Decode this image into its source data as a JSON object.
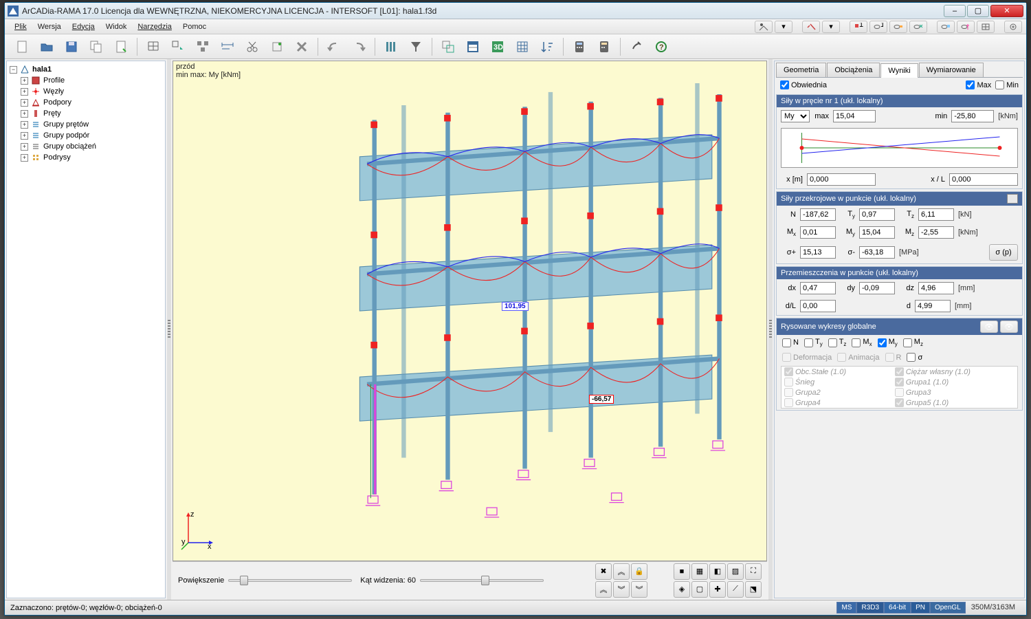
{
  "title": "ArCADia-RAMA 17.0 Licencja dla WEWNĘTRZNA, NIEKOMERCYJNA LICENCJA - INTERSOFT [L01]: hala1.f3d",
  "menu": {
    "plik": "Plik",
    "wersja": "Wersja",
    "edycja": "Edycja",
    "widok": "Widok",
    "narzedzia": "Narzędzia",
    "pomoc": "Pomoc"
  },
  "tree": {
    "root": "hala1",
    "items": [
      "Profile",
      "Węzły",
      "Podpory",
      "Pręty",
      "Grupy prętów",
      "Grupy podpór",
      "Grupy obciążeń",
      "Podrysy"
    ]
  },
  "viewport": {
    "view": "przód",
    "minmax": "min max: My [kNm]",
    "val_pos": "101,95",
    "val_neg": "-66,57"
  },
  "bottom": {
    "zoom": "Powiększenie",
    "fov": "Kąt widzenia: 60"
  },
  "tabs": {
    "geom": "Geometria",
    "obc": "Obciążenia",
    "wyn": "Wyniki",
    "wym": "Wymiarowanie"
  },
  "obwiednia": "Obwiednia",
  "max": "Max",
  "min": "Min",
  "sec1": {
    "title": "Siły w pręcie nr 1 (ukł. lokalny)",
    "select": "My",
    "max_lbl": "max",
    "max": "15,04",
    "min_lbl": "min",
    "min": "-25,80",
    "unit": "[kNm]",
    "xm": "x [m]",
    "xm_v": "0,000",
    "xl": "x / L",
    "xl_v": "0,000"
  },
  "sec2": {
    "title": "Siły przekrojowe w punkcie (ukł. lokalny)",
    "N": "-187,62",
    "Ty": "0,97",
    "Tz": "6,11",
    "u1": "[kN]",
    "Mx": "0,01",
    "My": "15,04",
    "Mz": "-2,55",
    "u2": "[kNm]",
    "sp": "15,13",
    "sm": "-63,18",
    "u3": "[MPa]",
    "btn": "σ (p)"
  },
  "sec3": {
    "title": "Przemieszczenia w punkcie (ukł. lokalny)",
    "dx": "0,47",
    "dy": "-0,09",
    "dz": "4,96",
    "u1": "[mm]",
    "dL": "0,00",
    "d": "4,99",
    "u2": "[mm]"
  },
  "sec4": {
    "title": "Rysowane wykresy globalne",
    "def": "Deformacja",
    "anim": "Animacja",
    "r": "R",
    "sig": "σ",
    "loads": [
      [
        "Obc.Stałe (1.0)",
        "Ciężar własny (1.0)"
      ],
      [
        "Śnieg",
        "Grupa1 (1.0)"
      ],
      [
        "Grupa2",
        "Grupa3"
      ],
      [
        "Grupa4",
        "Grupa5 (1.0)"
      ]
    ]
  },
  "status": {
    "left": "Zaznaczono: prętów-0; węzłów-0; obciążeń-0",
    "tags": [
      "MS",
      "R3D3",
      "64-bit",
      "PN",
      "OpenGL"
    ],
    "mem": "350M/3163M"
  }
}
